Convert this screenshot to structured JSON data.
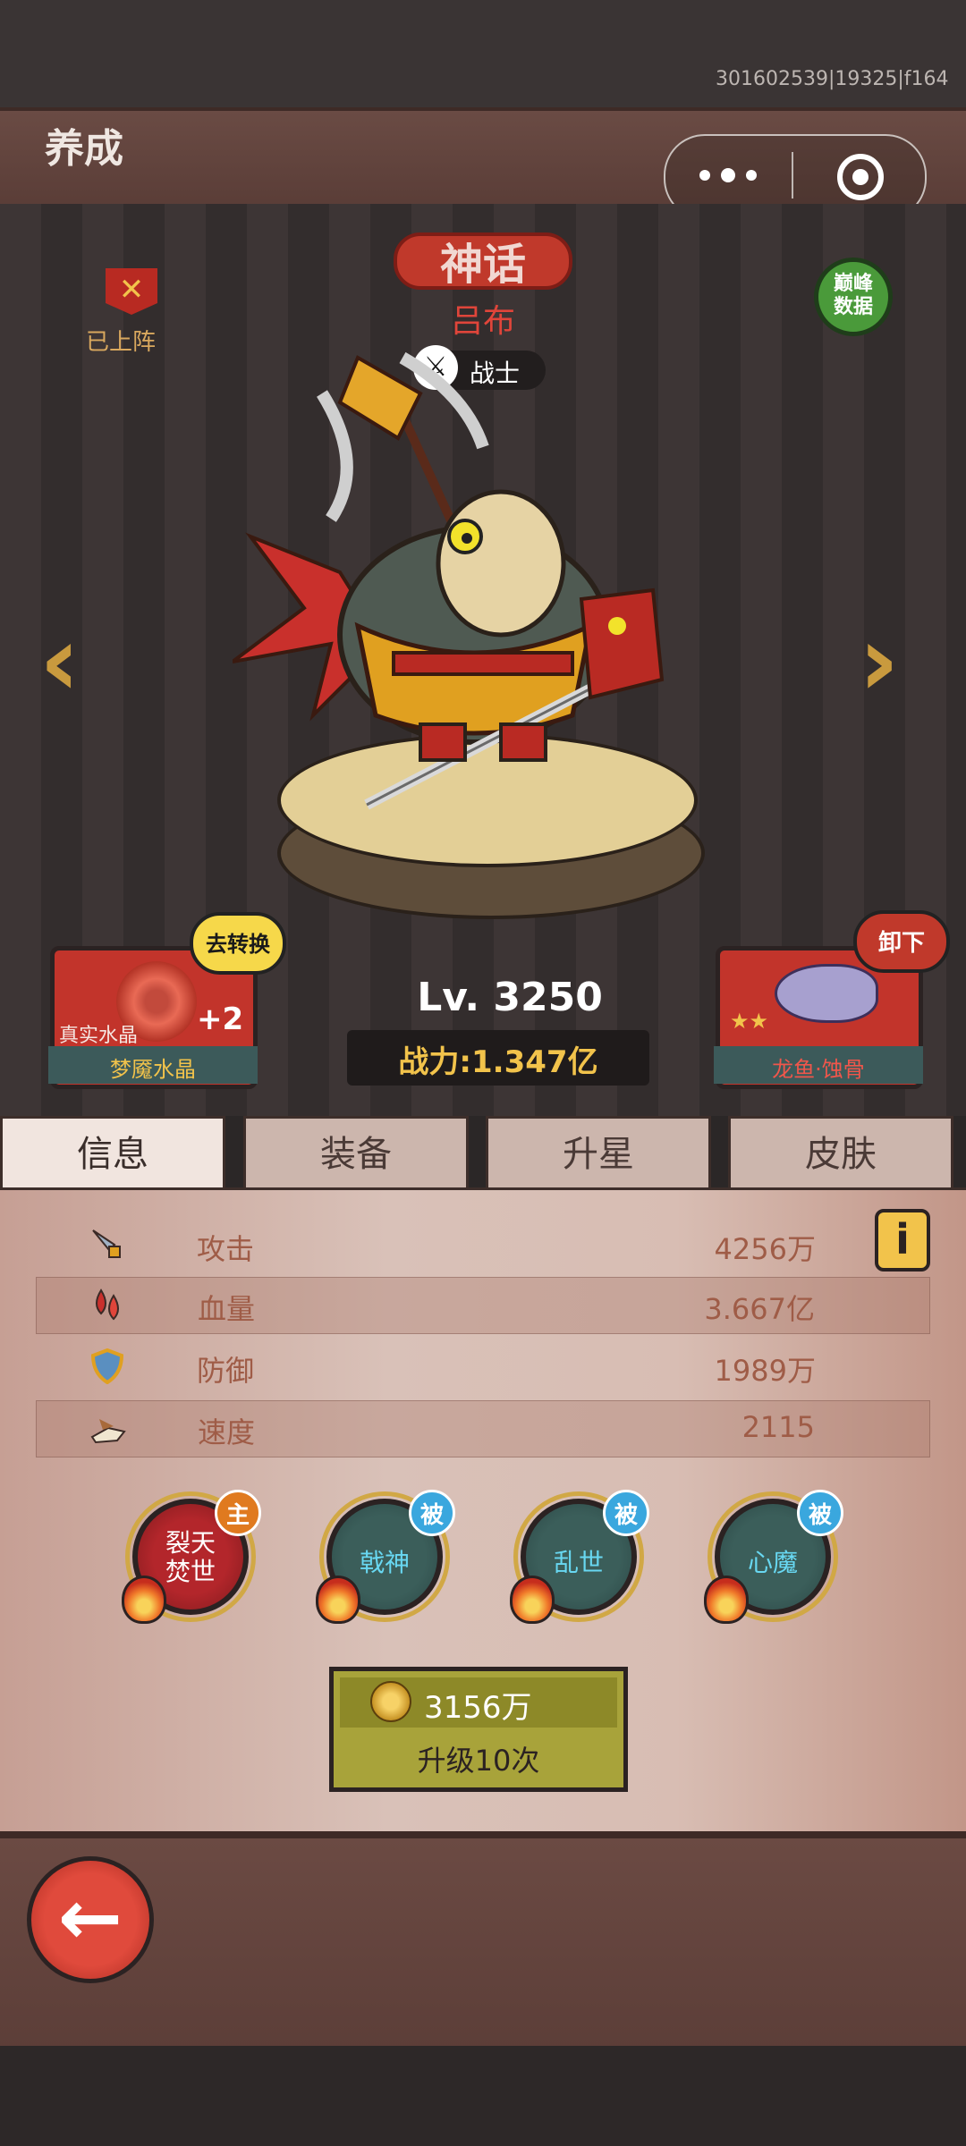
{
  "window": {
    "build_id": "301602539|19325|f164"
  },
  "header": {
    "title": "养成"
  },
  "hero": {
    "rarity": "神话",
    "name": "吕布",
    "class": "战士",
    "deployed_label": "已上阵",
    "peak_data_label": "巅峰\n数据",
    "level": "Lv. 3250",
    "power": "战力:1.347亿"
  },
  "left_card": {
    "sub_label": "真实水晶",
    "plus": "+2",
    "name": "梦魇水晶",
    "action": "去转换"
  },
  "right_card": {
    "name": "龙鱼·蚀骨",
    "stars": "★★",
    "action": "卸下"
  },
  "tabs": [
    {
      "label": "信息",
      "active": true
    },
    {
      "label": "装备",
      "active": false
    },
    {
      "label": "升星",
      "active": false
    },
    {
      "label": "皮肤",
      "active": false
    }
  ],
  "stats": [
    {
      "label": "攻击",
      "value": "4256万",
      "icon": "sword-icon"
    },
    {
      "label": "血量",
      "value": "3.667亿",
      "icon": "blood-icon"
    },
    {
      "label": "防御",
      "value": "1989万",
      "icon": "shield-icon"
    },
    {
      "label": "速度",
      "value": "2115",
      "icon": "speed-icon"
    }
  ],
  "skills": [
    {
      "name": "裂天\n焚世",
      "tag": "主",
      "type": "main"
    },
    {
      "name": "戟神",
      "tag": "被",
      "type": "passive"
    },
    {
      "name": "乱世",
      "tag": "被",
      "type": "passive"
    },
    {
      "name": "心魔",
      "tag": "被",
      "type": "passive"
    }
  ],
  "upgrade": {
    "cost": "3156万",
    "label": "升级10次"
  },
  "colors": {
    "accent_red": "#c0392b",
    "gold": "#f2c34b",
    "passive_blue": "#68d8f2"
  }
}
